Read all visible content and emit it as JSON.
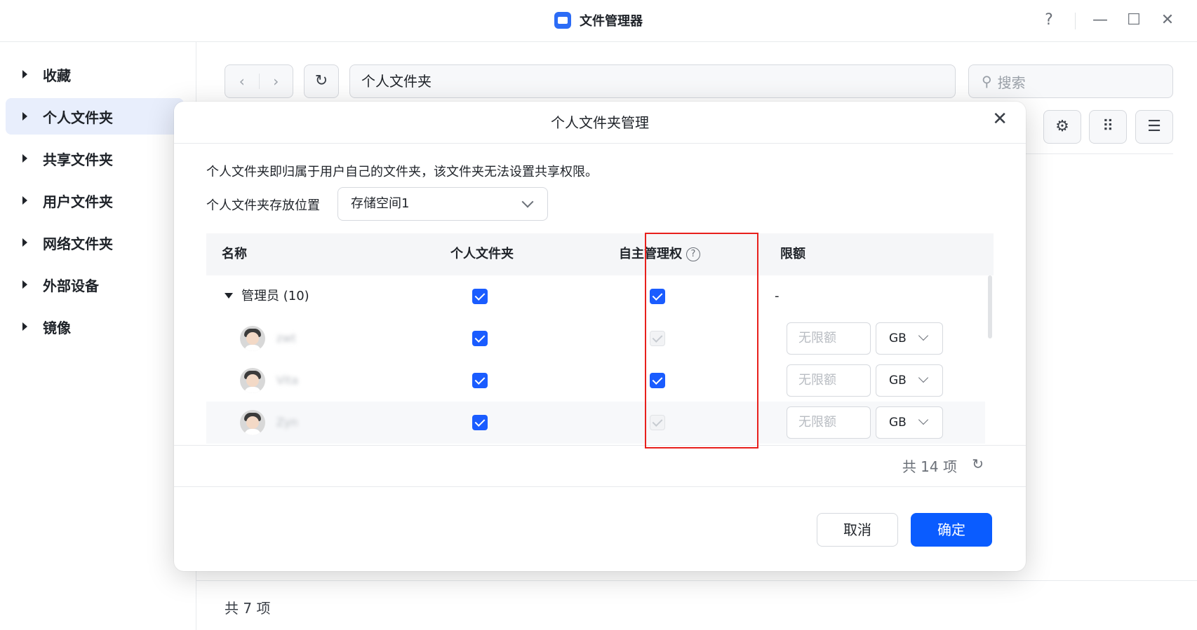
{
  "window": {
    "title": "文件管理器",
    "controls": {
      "help": "?",
      "minimize": "—",
      "maximize": "☐",
      "close": "✕"
    }
  },
  "sidebar": {
    "items": [
      {
        "label": "收藏",
        "active": false
      },
      {
        "label": "个人文件夹",
        "active": true
      },
      {
        "label": "共享文件夹",
        "active": false
      },
      {
        "label": "用户文件夹",
        "active": false
      },
      {
        "label": "网络文件夹",
        "active": false
      },
      {
        "label": "外部设备",
        "active": false
      },
      {
        "label": "镜像",
        "active": false
      }
    ]
  },
  "toolbar": {
    "path": "个人文件夹",
    "search_placeholder": "搜索"
  },
  "main": {
    "count_text": "共 7 项"
  },
  "dialog": {
    "title": "个人文件夹管理",
    "description": "个人文件夹即归属于用户自己的文件夹，该文件夹无法设置共享权限。",
    "location_label": "个人文件夹存放位置",
    "location_value": "存储空间1",
    "columns": {
      "name": "名称",
      "personal_folder": "个人文件夹",
      "self_manage": "自主管理权",
      "quota": "限额"
    },
    "group": {
      "label": "管理员 (10)",
      "personal": true,
      "self_manage": true,
      "quota": "-"
    },
    "users": [
      {
        "name": "zwt",
        "personal": true,
        "self_manage": "disabled",
        "quota_placeholder": "无限额",
        "unit": "GB"
      },
      {
        "name": "Vita",
        "personal": true,
        "self_manage": true,
        "quota_placeholder": "无限额",
        "unit": "GB"
      },
      {
        "name": "Zyn",
        "personal": true,
        "self_manage": "disabled",
        "quota_placeholder": "无限额",
        "unit": "GB"
      }
    ],
    "total_text": "共 14 项",
    "cancel_label": "取消",
    "ok_label": "确定"
  },
  "colors": {
    "accent": "#0a5cff",
    "highlight": "#e8201c",
    "sidebar_active": "#e8eefc"
  }
}
